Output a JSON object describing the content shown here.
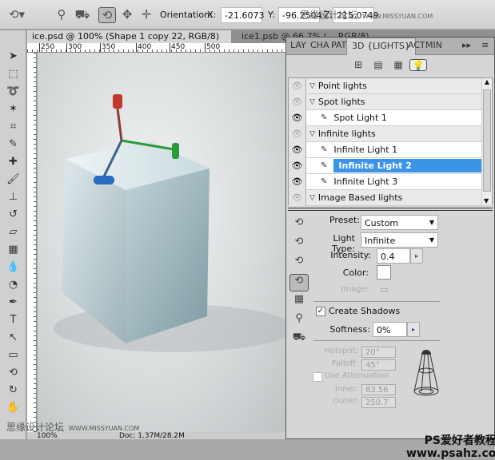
{
  "options_bar": {
    "orientation_label": "Orientation:",
    "x_label": "X:",
    "x_value": "-21.6073",
    "y_label": "Y:",
    "y_value": "-96.2504",
    "z_label": "Z:",
    "z_value": "215.0749"
  },
  "watermark_top": {
    "cn": "思缘设计论坛",
    "url": "WWW.MISSYUAN.COM"
  },
  "doc_tabs": [
    {
      "label": "ice.psd @ 100% (Shape 1 copy 22, RGB/8) *"
    },
    {
      "label": "ice1.psb @ 66.7% (... RGB/8)"
    }
  ],
  "ruler": {
    "h_ticks": [
      "250",
      "300",
      "350",
      "400",
      "450",
      "500"
    ],
    "v_ticks": [
      "5",
      "0",
      "0"
    ]
  },
  "status": {
    "zoom": "100%",
    "doc": "Doc: 1.37M/28.2M"
  },
  "watermark_bottom": {
    "cn": "思缘设计论坛",
    "url": "WWW.MISSYUAN.COM"
  },
  "panel": {
    "tabs": [
      "LAY",
      "CHA",
      "PAT",
      "3D {LIGHTS}",
      "ACT",
      "MIN"
    ],
    "lights": [
      {
        "label": "Point lights",
        "type": "group",
        "visible": false
      },
      {
        "label": "Spot lights",
        "type": "group",
        "visible": false
      },
      {
        "label": "Spot Light 1",
        "type": "item",
        "visible": true
      },
      {
        "label": "Infinite lights",
        "type": "group",
        "visible": false
      },
      {
        "label": "Infinite Light 1",
        "type": "item",
        "visible": true
      },
      {
        "label": "Infinite Light 2",
        "type": "item",
        "visible": true,
        "selected": true
      },
      {
        "label": "Infinite Light 3",
        "type": "item",
        "visible": true
      },
      {
        "label": "Image Based lights",
        "type": "group",
        "visible": false
      }
    ],
    "preset_label": "Preset:",
    "preset_value": "Custom",
    "light_type_label": "Light Type:",
    "light_type_value": "Infinite",
    "intensity_label": "Intensity:",
    "intensity_value": "0.4",
    "color_label": "Color:",
    "color_value": "#ffffff",
    "image_label": "Image:",
    "create_shadows_label": "Create Shadows",
    "create_shadows_checked": true,
    "softness_label": "Softness:",
    "softness_value": "0%",
    "hotspot_label": "Hotspot:",
    "hotspot_value": "20°",
    "falloff_label": "Falloff:",
    "falloff_value": "45°",
    "attenuation_label": "Use Attenuation",
    "attenuation_checked": false,
    "inner_label": "Inner:",
    "inner_value": "83.56",
    "outer_label": "Outer:",
    "outer_value": "250.7"
  },
  "watermark_panel": {
    "cn": "PS爱好者教程网",
    "url": "www.psahz.com"
  },
  "colors": {
    "selection": "#3c94e8",
    "axis_x": "#2a9a3a",
    "axis_y": "#c0392b",
    "axis_z": "#2a6cc0"
  }
}
